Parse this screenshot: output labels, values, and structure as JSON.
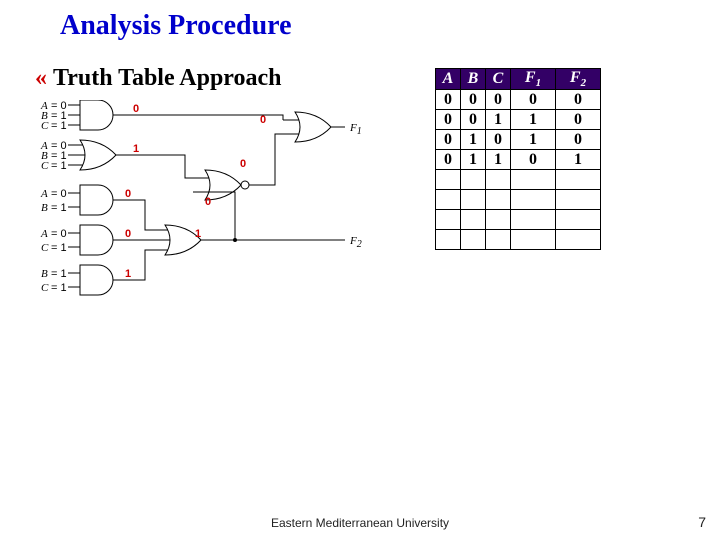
{
  "title": "Analysis Procedure",
  "subtitle": "Truth Table Approach",
  "bullet_glyph": "«",
  "footer": "Eastern Mediterranean University",
  "page_number": "7",
  "circuit": {
    "inputs": {
      "g1": {
        "A": "= 0",
        "B": "= 1",
        "C": "= 1"
      },
      "g2": {
        "A": "= 0",
        "B": "= 1",
        "C": "= 1"
      },
      "g3": {
        "A": "= 0",
        "B": "= 1"
      },
      "g4": {
        "A": "= 0",
        "C": "= 1"
      },
      "g5": {
        "B": "= 1",
        "C": "= 1"
      }
    },
    "gate_outputs": {
      "g1": "0",
      "g2": "1",
      "g3": "0",
      "g4": "0",
      "g5": "1",
      "nor_in_top": "0",
      "nor_in_bot": "0",
      "nor_out": "0",
      "or_mid": "1"
    },
    "outputs": {
      "F1": "F",
      "F1sub": "1",
      "F2": "F",
      "F2sub": "2"
    }
  },
  "truth_table": {
    "headers": [
      {
        "label": "A"
      },
      {
        "label": "B"
      },
      {
        "label": "C"
      },
      {
        "label": "F",
        "sub": "1"
      },
      {
        "label": "F",
        "sub": "2"
      }
    ],
    "rows": [
      [
        "0",
        "0",
        "0",
        "0",
        "0"
      ],
      [
        "0",
        "0",
        "1",
        "1",
        "0"
      ],
      [
        "0",
        "1",
        "0",
        "1",
        "0"
      ],
      [
        "0",
        "1",
        "1",
        "0",
        "1"
      ],
      [
        "",
        "",
        "",
        "",
        ""
      ],
      [
        "",
        "",
        "",
        "",
        ""
      ],
      [
        "",
        "",
        "",
        "",
        ""
      ],
      [
        "",
        "",
        "",
        "",
        ""
      ]
    ]
  }
}
